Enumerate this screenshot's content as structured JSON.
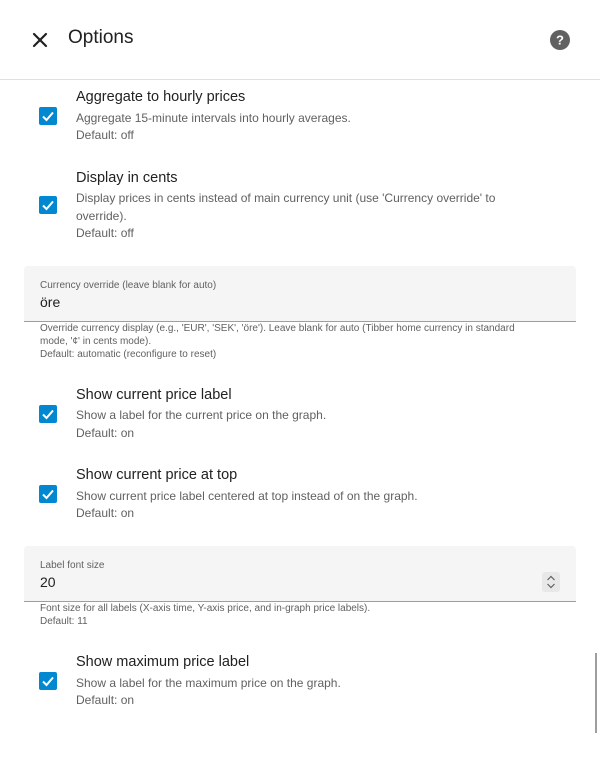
{
  "header": {
    "title": "Options",
    "close_icon": "close-icon",
    "help_icon": "help-icon"
  },
  "colors": {
    "accent": "#0288d1"
  },
  "options": [
    {
      "title": "Aggregate to hourly prices",
      "desc": "Aggregate 15-minute intervals into hourly averages.",
      "default": "Default: off",
      "checked": true
    },
    {
      "title": "Display in cents",
      "desc": "Display prices in cents instead of main currency unit (use 'Currency override' to override).",
      "default": "Default: off",
      "checked": true
    },
    {
      "title": "Show current price label",
      "desc": "Show a label for the current price on the graph.",
      "default": "Default: on",
      "checked": true
    },
    {
      "title": "Show current price at top",
      "desc": "Show current price label centered at top instead of on the graph.",
      "default": "Default: on",
      "checked": true
    },
    {
      "title": "Show maximum price label",
      "desc": "Show a label for the maximum price on the graph.",
      "default": "Default: on",
      "checked": true
    }
  ],
  "currency_field": {
    "label": "Currency override (leave blank for auto)",
    "value": "öre",
    "help": "Override currency display (e.g., 'EUR', 'SEK', 'öre'). Leave blank for auto (Tibber home currency in standard mode, '¢' in cents mode).",
    "default": "Default: automatic (reconfigure to reset)"
  },
  "font_field": {
    "label": "Label font size",
    "value": "20",
    "help": "Font size for all labels (X-axis time, Y-axis price, and in-graph price labels).",
    "default": "Default: 11"
  }
}
